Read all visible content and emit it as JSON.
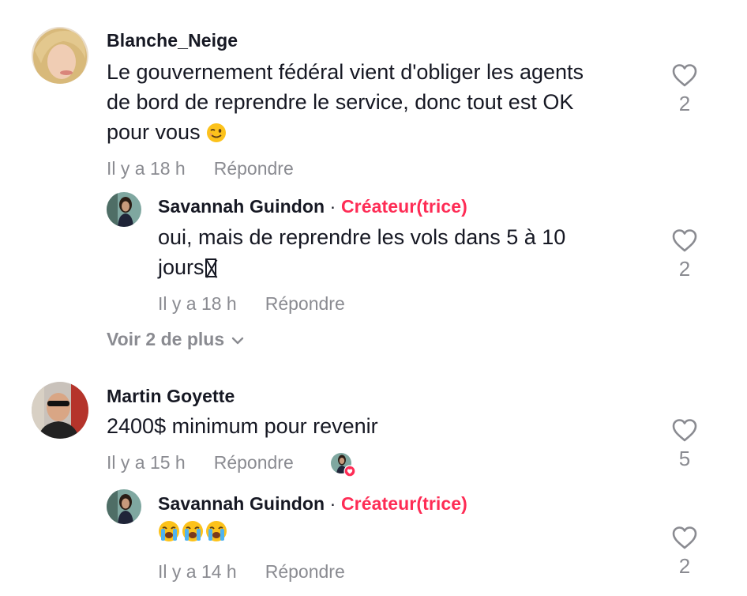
{
  "comments": [
    {
      "username": "Blanche_Neige",
      "text_line1": "Le gouvernement fédéral vient d'obliger les agents",
      "text_line2": "de bord de reprendre le service, donc tout est OK",
      "text_line3": "pour vous",
      "emoji": "winking-face",
      "time": "Il y a 18 h",
      "reply_label": "Répondre",
      "likes": "2",
      "reply": {
        "username": "Savannah Guindon",
        "separator": "·",
        "badge": "Créateur(trice)",
        "text_line1": "oui, mais de reprendre les vols dans 5 à 10",
        "text_line2": "jours",
        "time": "Il y a 18 h",
        "reply_label": "Répondre",
        "likes": "2"
      },
      "more_label": "Voir 2 de plus"
    },
    {
      "username": "Martin Goyette",
      "text": "2400$ minimum pour revenir",
      "time": "Il y a 15 h",
      "reply_label": "Répondre",
      "likes": "5",
      "reply": {
        "username": "Savannah Guindon",
        "separator": "·",
        "badge": "Créateur(trice)",
        "emoji": "loudly-crying-face x3",
        "time": "Il y a 14 h",
        "reply_label": "Répondre",
        "likes": "2"
      }
    }
  ],
  "colors": {
    "text": "#161823",
    "muted": "#8a8b91",
    "creator_badge": "#fe2c55",
    "heart_outline": "#8a8b91"
  },
  "icons": {
    "like": "heart-outline-icon",
    "expand": "chevron-down-icon",
    "creator_liked": "creator-liked-avatar-icon"
  }
}
